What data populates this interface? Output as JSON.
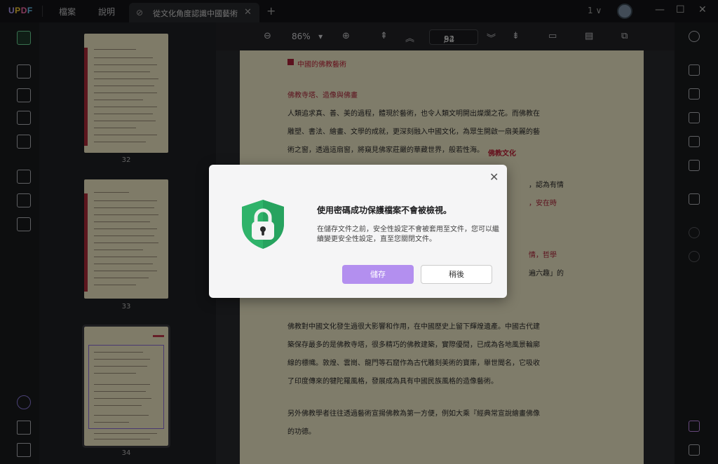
{
  "app": {
    "logo": "UPDF"
  },
  "menu": {
    "file": "檔案",
    "help": "說明"
  },
  "tab": {
    "title": "從文化角度認識中國藝術",
    "close": "✕",
    "add": "+"
  },
  "window": {
    "count": "1",
    "chevron": "∨",
    "minimize": "—",
    "maximize": "☐",
    "close": "✕"
  },
  "toolbar": {
    "zoom": "86%",
    "zoom_caret": "▾",
    "page_current": "34",
    "page_total": "92",
    "page_sep": "/"
  },
  "thumbnails": [
    {
      "page": "32"
    },
    {
      "page": "33"
    },
    {
      "page": "34"
    }
  ],
  "document": {
    "header": "中國的佛教藝術",
    "section": "佛教寺塔、造像與佛畫",
    "p1_l1": "人類追求真、善、美的過程，體現於藝術，也令人類文明開出燦爛之花。而佛教在",
    "p1_l2": "雕塑、書法、繪畫、文學的成就，更深刻融入中國文化，為眾生開啟一扇美麗的藝",
    "p1_l3": "術之窗，透過這扇窗，將窺見佛家莊嚴的華藏世界，般若性海。",
    "annotation": "佛教文化",
    "frag_r1": "，認為有情",
    "frag_r2": "，安在時",
    "frag_r3": "情，哲學",
    "frag_r4": "遍六趣」的",
    "p2_l1": "佛教對中國文化發生過很大影響和作用，在中國歷史上留下輝煌遺產。中國古代建",
    "p2_l2": "築保存最多的是佛教寺塔，很多精巧的佛教建築，實際優閒，已成為各地風景輪廓",
    "p2_l3": "線的標幟。敦煌、雲崗、龍門等石窟作為古代雕刻美術的寶庫，舉世聞名，它吸收",
    "p2_l4": "了印度傳來的犍陀羅風格，發展成為具有中國民族風格的造像藝術。",
    "p3_l1": "另外佛教學者往往透過藝術宣揚佛教為第一方便，例如大乘『經典常宣說繪畫佛像",
    "p3_l2": "的功德。"
  },
  "dialog": {
    "title": "使用密碼成功保護檔案不會被檢視。",
    "body": "在儲存文件之前，安全性設定不會被套用至文件，您可以繼續變更安全性設定，直至您關閉文件。",
    "save": "儲存",
    "later": "稍後",
    "close": "✕"
  },
  "colors": {
    "accent": "#b38fef",
    "shield": "#2fb36a",
    "annotation": "#c11f36"
  }
}
